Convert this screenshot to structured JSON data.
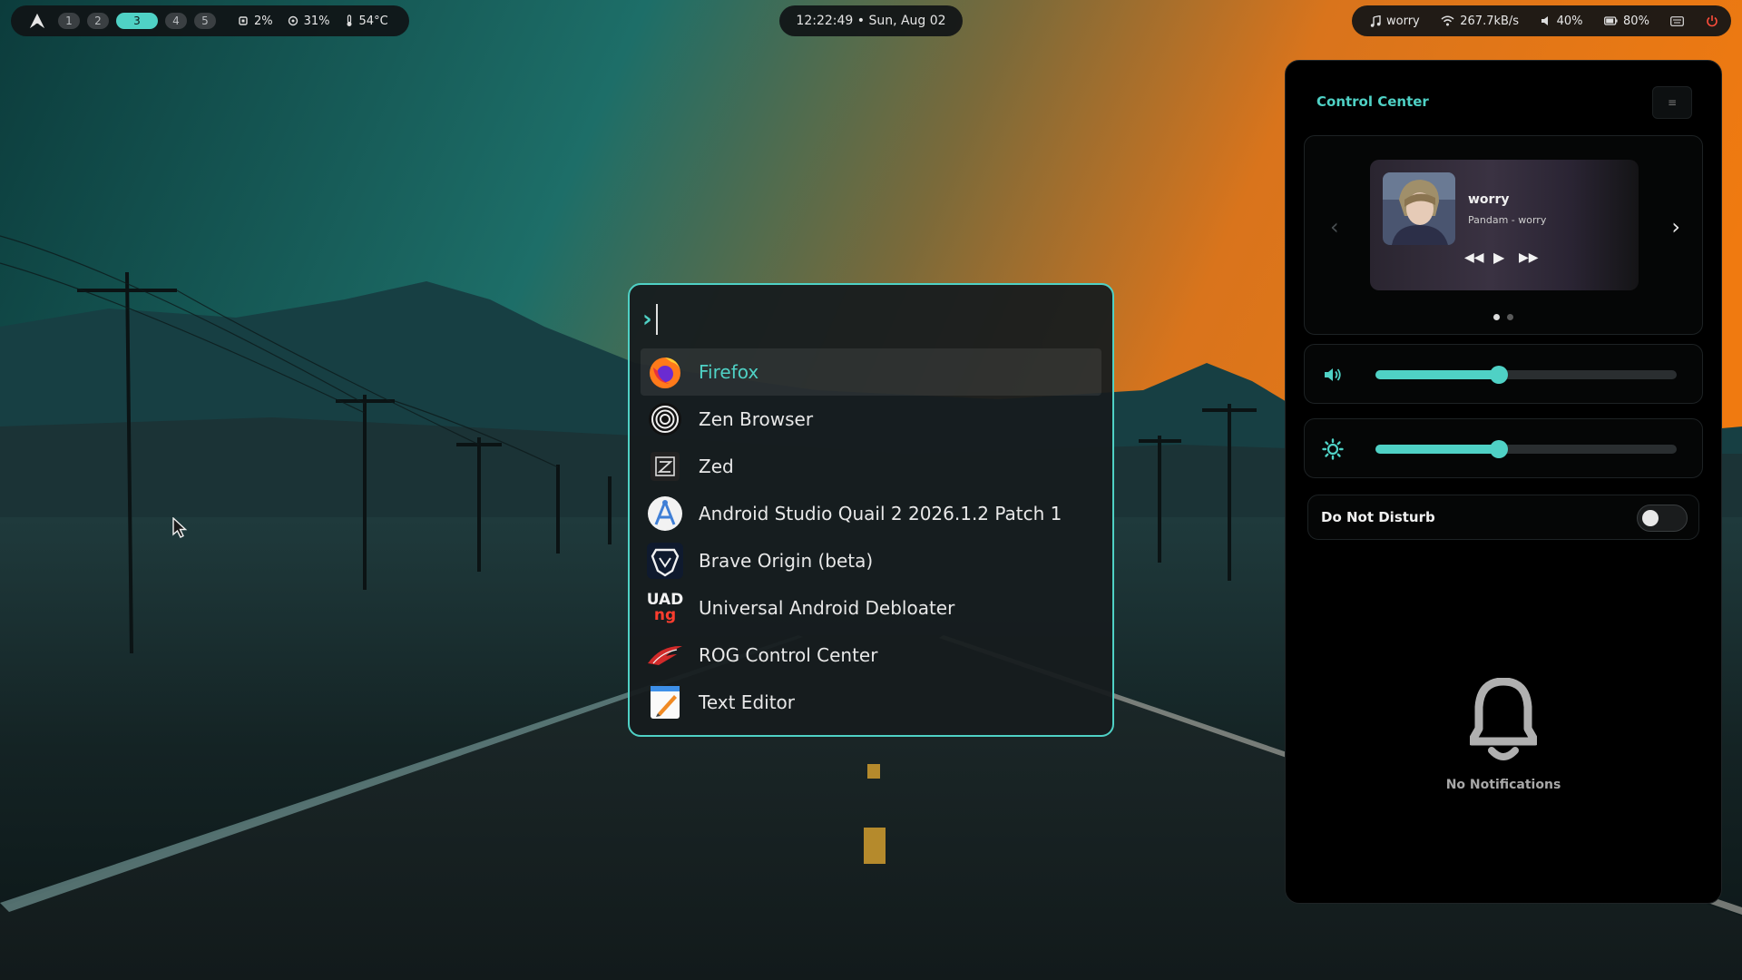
{
  "topbar": {
    "logo_icon": "arch-logo-icon",
    "workspaces": [
      {
        "label": "1",
        "active": false
      },
      {
        "label": "2",
        "active": false
      },
      {
        "label": "3",
        "active": true
      },
      {
        "label": "4",
        "active": false
      },
      {
        "label": "5",
        "active": false
      }
    ],
    "cpu": "2%",
    "memory": "31%",
    "temperature": "54°C",
    "clock": "12:22:49 • Sun, Aug 02",
    "now_playing": "worry",
    "network_speed": "267.7kB/s",
    "volume": "40%",
    "battery": "80%"
  },
  "launcher": {
    "query": "",
    "prompt_icon": "chevron-right-icon",
    "apps": [
      {
        "label": "Firefox",
        "icon": "firefox-icon",
        "selected": true
      },
      {
        "label": "Zen Browser",
        "icon": "zen-browser-icon",
        "selected": false
      },
      {
        "label": "Zed",
        "icon": "zed-icon",
        "selected": false
      },
      {
        "label": "Android Studio Quail 2 2026.1.2 Patch 1",
        "icon": "android-studio-icon",
        "selected": false
      },
      {
        "label": "Brave Origin (beta)",
        "icon": "brave-icon",
        "selected": false
      },
      {
        "label": "Universal Android Debloater",
        "icon": "uad-icon",
        "selected": false
      },
      {
        "label": "ROG Control Center",
        "icon": "rog-icon",
        "selected": false
      },
      {
        "label": "Text Editor",
        "icon": "text-editor-icon",
        "selected": false
      }
    ],
    "uad_icon_text": [
      "UAD",
      "ng"
    ]
  },
  "control_center": {
    "title": "Control Center",
    "media": {
      "title": "worry",
      "artist": "Pandam - worry",
      "page": 1,
      "pages": 2
    },
    "volume_level": 0.41,
    "brightness_level": 0.41,
    "dnd": {
      "label": "Do Not Disturb",
      "enabled": false
    },
    "notifications_empty": "No Notifications"
  },
  "colors": {
    "accent": "#4fd1c5",
    "panel": "#000000",
    "bar": "#101416"
  }
}
